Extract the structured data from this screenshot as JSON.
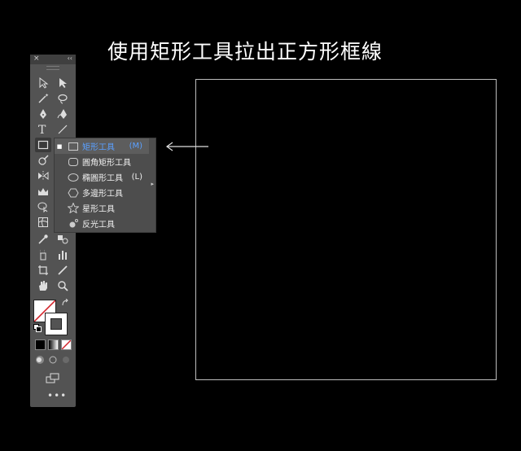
{
  "heading": "使用矩形工具拉出正方形框線",
  "toolbar": {
    "close_glyph": "×",
    "collapse_glyph": "‹‹",
    "more_glyph": "•••"
  },
  "flyout": {
    "items": [
      {
        "label": "矩形工具",
        "shortcut": "(M)",
        "icon": "rectangle-icon",
        "selected": true
      },
      {
        "label": "圓角矩形工具",
        "shortcut": "",
        "icon": "rounded-rectangle-icon",
        "selected": false
      },
      {
        "label": "橢圓形工具",
        "shortcut": "(L)",
        "icon": "ellipse-icon",
        "selected": false
      },
      {
        "label": "多邊形工具",
        "shortcut": "",
        "icon": "polygon-icon",
        "selected": false
      },
      {
        "label": "星形工具",
        "shortcut": "",
        "icon": "star-icon",
        "selected": false
      },
      {
        "label": "反光工具",
        "shortcut": "",
        "icon": "flare-icon",
        "selected": false
      }
    ]
  },
  "colors": {
    "background": "#000000",
    "panel": "#535353",
    "selected_text": "#5aa0ff"
  }
}
